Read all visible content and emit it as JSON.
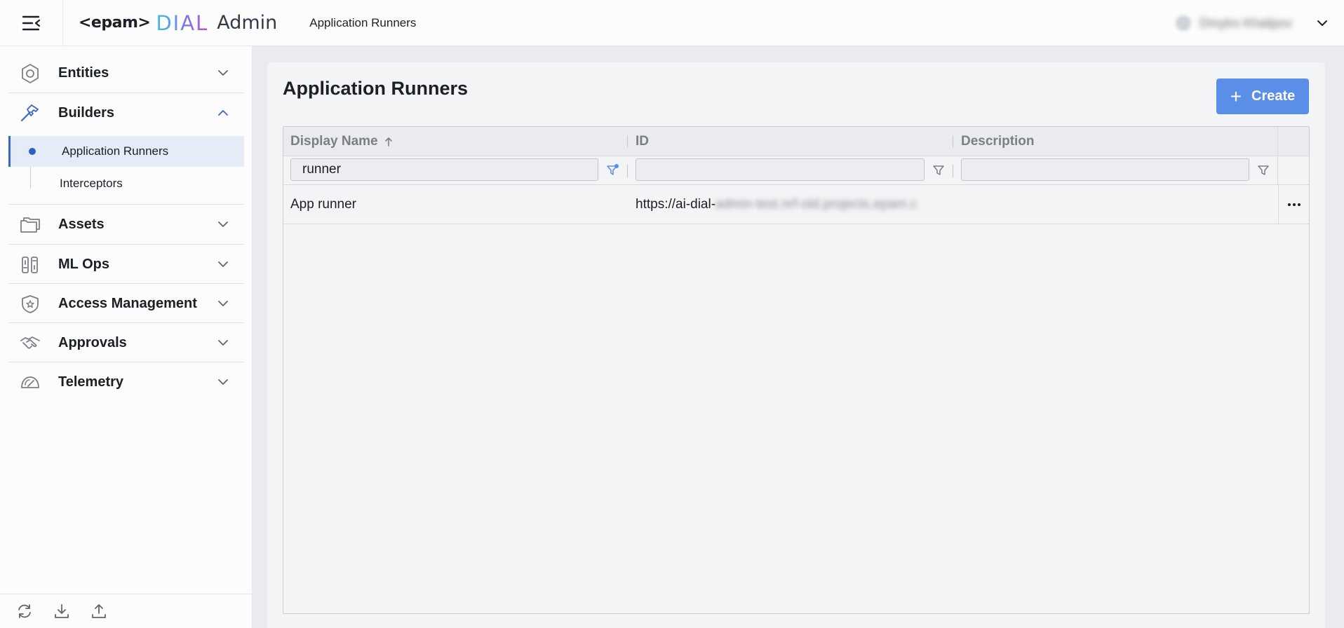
{
  "header": {
    "logo_epam": "<epam>",
    "logo_dial": "DIAL",
    "logo_admin": "Admin",
    "breadcrumb": "Application Runners",
    "user_name": "Dmytro Khalipov"
  },
  "sidebar": {
    "sections": [
      {
        "label": "Entities",
        "expanded": false,
        "icon": "hexagon-icon"
      },
      {
        "label": "Builders",
        "expanded": true,
        "icon": "hammer-icon"
      },
      {
        "label": "Assets",
        "expanded": false,
        "icon": "folders-icon"
      },
      {
        "label": "ML Ops",
        "expanded": false,
        "icon": "ml-ops-icon"
      },
      {
        "label": "Access Management",
        "expanded": false,
        "icon": "shield-star-icon"
      },
      {
        "label": "Approvals",
        "expanded": false,
        "icon": "handshake-icon"
      },
      {
        "label": "Telemetry",
        "expanded": false,
        "icon": "gauge-icon"
      }
    ],
    "builders_items": [
      {
        "label": "Application Runners",
        "active": true
      },
      {
        "label": "Interceptors",
        "active": false
      }
    ],
    "footer_icons": [
      "refresh-icon",
      "download-icon",
      "upload-icon"
    ]
  },
  "main": {
    "title": "Application Runners",
    "create_label": "Create",
    "accent_color": "#5b8ee6",
    "grid": {
      "columns": [
        {
          "label": "Display Name",
          "sort": "asc",
          "filter_value": "runner",
          "filter_active": true
        },
        {
          "label": "ID",
          "sort": "",
          "filter_value": "",
          "filter_active": false
        },
        {
          "label": "Description",
          "sort": "",
          "filter_value": "",
          "filter_active": false
        }
      ],
      "rows": [
        {
          "display_name": "App runner",
          "id_visible": "https://ai-dial-",
          "id_blurred": "admin-test.nrf-old.projects.epam.c",
          "description": ""
        }
      ]
    }
  }
}
